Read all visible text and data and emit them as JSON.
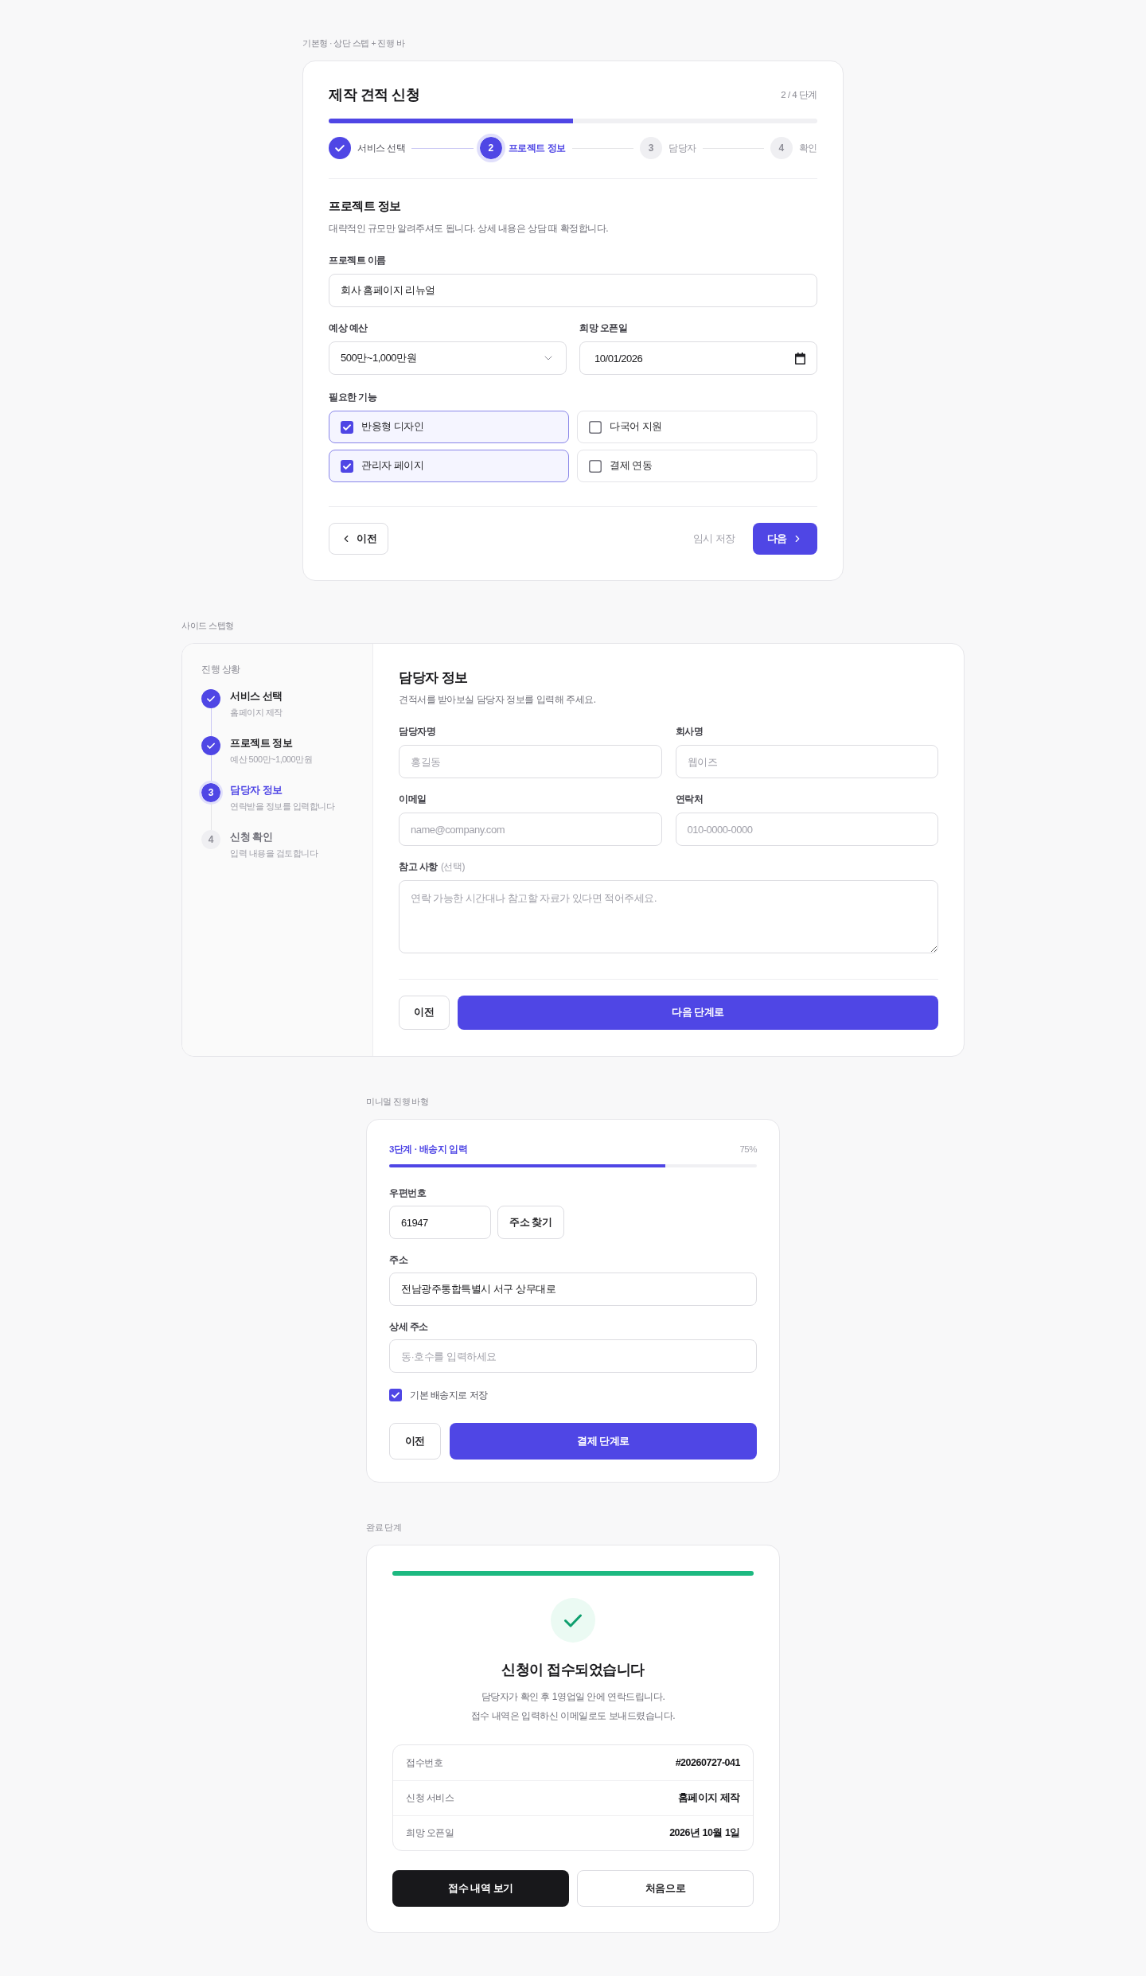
{
  "basic": {
    "caption": "기본형 · 상단 스텝 + 진행 바",
    "title": "제작 견적 신청",
    "step_counter": "2 / 4 단계",
    "progress": {
      "level": 0.5
    },
    "steps": [
      {
        "label": "서비스 선택",
        "done": true,
        "selected": false
      },
      {
        "number": "2",
        "label": "프로젝트 정보",
        "done": false,
        "selected": true
      },
      {
        "number": "3",
        "label": "담당자",
        "done": false,
        "selected": false
      },
      {
        "number": "4",
        "label": "확인",
        "done": false,
        "selected": false
      }
    ],
    "section_title": "프로젝트 정보",
    "section_description": "대략적인 규모만 알려주셔도 됩니다. 상세 내용은 상담 때 확정합니다.",
    "project_name": {
      "label": "프로젝트 이름",
      "value": "회사 홈페이지 리뉴얼"
    },
    "budget": {
      "label": "예상 예산",
      "value": "500만~1,000만원"
    },
    "open_date": {
      "label": "희망 오픈일",
      "value": "10/01/2026"
    },
    "features": {
      "label": "필요한 기능",
      "options": [
        {
          "label": "반응형 디자인",
          "checked": true
        },
        {
          "label": "다국어 지원",
          "checked": false
        },
        {
          "label": "관리자 페이지",
          "checked": true
        },
        {
          "label": "결제 연동",
          "checked": false
        }
      ]
    },
    "actions": {
      "back": "이전",
      "save_draft": "임시 저장",
      "next": "다음"
    }
  },
  "side": {
    "caption": "사이드 스텝형",
    "sidebar_title": "진행 상황",
    "steps": [
      {
        "title": "서비스 선택",
        "detail": "홈페이지 제작",
        "done": true,
        "selected": false
      },
      {
        "title": "프로젝트 정보",
        "detail": "예산 500만~1,000만원",
        "done": true,
        "selected": false
      },
      {
        "number": "3",
        "title": "담당자 정보",
        "detail": "연락받을 정보를 입력합니다",
        "done": false,
        "selected": true
      },
      {
        "number": "4",
        "title": "신청 확인",
        "detail": "입력 내용을 검토합니다",
        "done": false,
        "selected": false
      }
    ],
    "title": "담당자 정보",
    "description": "견적서를 받아보실 담당자 정보를 입력해 주세요.",
    "fields": [
      {
        "kind": "text",
        "label": "담당자명",
        "placeholder": "홍길동"
      },
      {
        "kind": "text",
        "label": "회사명",
        "placeholder": "웹이즈"
      },
      {
        "kind": "text",
        "label": "이메일",
        "placeholder": "name@company.com"
      },
      {
        "kind": "text",
        "label": "연락처",
        "placeholder": "010-0000-0000"
      },
      {
        "kind": "textarea",
        "label": "참고 사항",
        "optional": "(선택)",
        "placeholder": "연락 가능한 시간대나 참고할 자료가 있다면 적어주세요."
      }
    ],
    "actions": {
      "back": "이전",
      "next": "다음 단계로"
    }
  },
  "minimal": {
    "caption": "미니멀 진행 바형",
    "step_title": "3단계 · 배송지 입력",
    "percent": "75%",
    "progress": {
      "level": 0.75
    },
    "postal_code": {
      "label": "우편번호",
      "value": "61947",
      "button": "주소 찾기"
    },
    "address": {
      "label": "주소",
      "value": "전남광주통합특별시 서구 상무대로"
    },
    "address_detail": {
      "label": "상세 주소",
      "placeholder": "동·호수를 입력하세요"
    },
    "save_default": {
      "label": "기본 배송지로 저장",
      "checked": true
    },
    "actions": {
      "back": "이전",
      "next": "결제 단계로"
    }
  },
  "complete": {
    "caption": "완료 단계",
    "title": "신청이 접수되었습니다",
    "message": [
      "담당자가 확인 후 1영업일 안에 연락드립니다.",
      "접수 내역은 입력하신 이메일로도 보내드렸습니다."
    ],
    "summary": [
      {
        "label": "접수번호",
        "value": "#20260727-041"
      },
      {
        "label": "신청 서비스",
        "value": "홈페이지 제작"
      },
      {
        "label": "희망 오픈일",
        "value": "2026년 10월 1일"
      }
    ],
    "actions": {
      "primary": "접수 내역 보기",
      "secondary": "처음으로"
    }
  }
}
